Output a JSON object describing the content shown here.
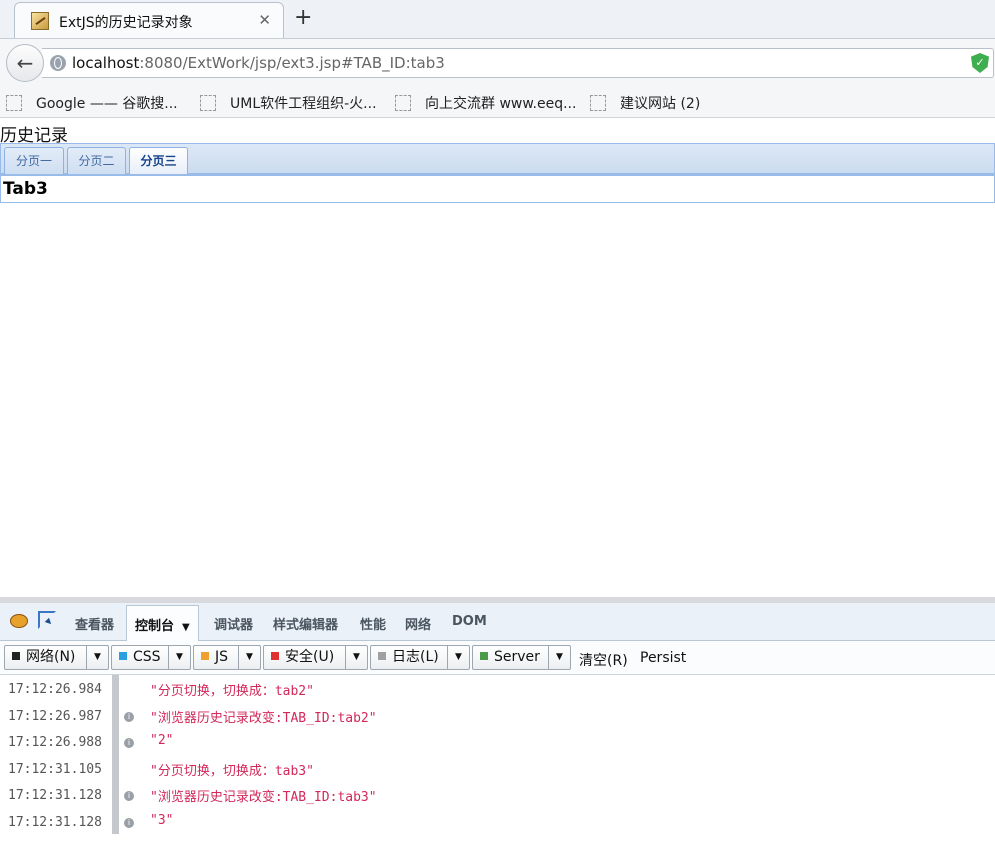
{
  "browser": {
    "tab": {
      "title": "ExtJS的历史记录对象",
      "close_glyph": "✕"
    },
    "new_tab_glyph": "+",
    "back_glyph": "←",
    "url": {
      "host": "localhost",
      "path": ":8080/ExtWork/jsp/ext3.jsp#TAB_ID:tab3"
    },
    "bookmarks": [
      "Google —— 谷歌搜...",
      "UML软件工程组织-火...",
      "向上交流群 www.eeq...",
      "建议网站 (2)"
    ]
  },
  "page": {
    "heading": "历史记录",
    "tabs": [
      "分页一",
      "分页二",
      "分页三"
    ],
    "active_tab": 2,
    "content": "Tab3"
  },
  "devtools": {
    "tabs": [
      "查看器",
      "控制台",
      "调试器",
      "样式编辑器",
      "性能",
      "网络",
      "DOM"
    ],
    "active_tab_arrow": "▼",
    "filters": [
      {
        "label": "网络(N)",
        "color": "#222222"
      },
      {
        "label": "CSS",
        "color": "#2aa0e0"
      },
      {
        "label": "JS",
        "color": "#f0a030"
      },
      {
        "label": "安全(U)",
        "color": "#e03030"
      },
      {
        "label": "日志(L)",
        "color": "#a0a0a0"
      },
      {
        "label": "Server",
        "color": "#4a9a4a"
      }
    ],
    "dropdown_glyph": "▼",
    "clear_label": "清空(R)",
    "persist_label": "Persist",
    "info_glyph": "i",
    "logs": [
      {
        "time": "17:12:26.984",
        "msg": "\"分页切换，切换成：tab2\"",
        "info": false
      },
      {
        "time": "17:12:26.987",
        "msg": "\"浏览器历史记录改变:TAB_ID:tab2\"",
        "info": true
      },
      {
        "time": "17:12:26.988",
        "msg": "\"2\"",
        "info": true
      },
      {
        "time": "17:12:31.105",
        "msg": "\"分页切换，切换成：tab3\"",
        "info": false
      },
      {
        "time": "17:12:31.128",
        "msg": "\"浏览器历史记录改变:TAB_ID:tab3\"",
        "info": true
      },
      {
        "time": "17:12:31.128",
        "msg": "\"3\"",
        "info": true
      }
    ]
  }
}
